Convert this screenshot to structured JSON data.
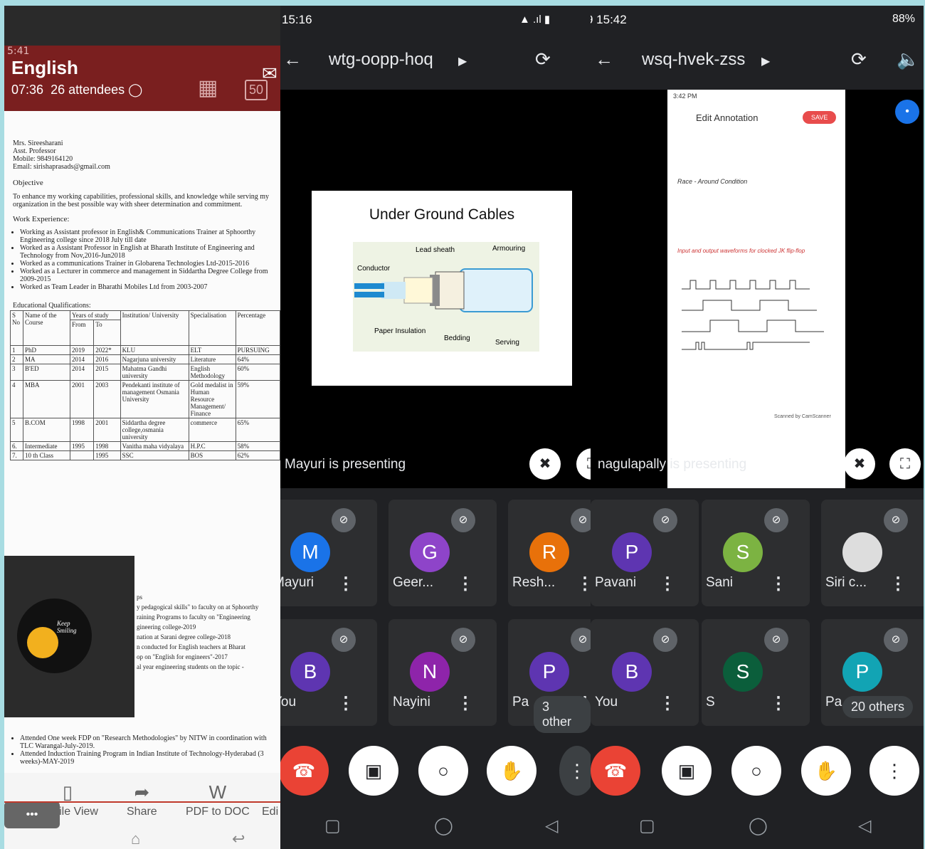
{
  "panel1": {
    "status": "5:41",
    "language": "English",
    "duration": "07:36",
    "attendees": "26 attendees",
    "badge": "50",
    "resume": {
      "name": "Mrs. Sireesharani",
      "role": "Asst. Professor",
      "mobile": "Mobile: 9849164120",
      "email": "Email: sirishaprasads@gmail.com",
      "objective_head": "Objective",
      "objective": "To enhance my working capabilities, professional skills, and knowledge while serving my organization in the best possible way with sheer determination and commitment.",
      "exp_head": "Work Experience:",
      "experience": [
        "Working as Assistant professor in English& Communications Trainer at Sphoorthy Engineering college since 2018 July till date",
        "Worked as a Assistant Professor in English at Bharath Institute of Engineering and Technology from Nov,2016-Jun2018",
        "Worked as a communications Trainer in Globarena Technologies Ltd-2015-2016",
        "Worked as a Lecturer in commerce and management in Siddartha Degree College from 2009-2015",
        "Worked as Team Leader in Bharathi Mobiles Ltd from 2003-2007"
      ],
      "edu_head": "Educational Qualifications:",
      "table_headers": [
        "S No",
        "Name of the Course",
        "Years of study",
        "Institution/ University",
        "Specialisation",
        "Percentage"
      ],
      "sub_headers": [
        "From",
        "To"
      ],
      "rows": [
        [
          "1",
          "PhD",
          "2019",
          "2022*",
          "KLU",
          "ELT",
          "PURSUING"
        ],
        [
          "2",
          "MA",
          "2014",
          "2016",
          "Nagarjuna university",
          "Literature",
          "64%"
        ],
        [
          "3",
          "B'ED",
          "2014",
          "2015",
          "Mahatma Gandhi university",
          "English Methodology",
          "60%"
        ],
        [
          "4",
          "MBA",
          "2001",
          "2003",
          "Pendekanti institute of management Osmania University",
          "Gold medalist in Human Resource Management/ Finance",
          "59%"
        ],
        [
          "5",
          "B.COM",
          "1998",
          "2001",
          "Siddartha degree college,osmania university",
          "commerce",
          "65%"
        ],
        [
          "6.",
          "Intermediate",
          "1995",
          "1998",
          "Vanitha maha vidyalaya",
          "H.P.C",
          "58%"
        ],
        [
          "7.",
          "10 th Class",
          "",
          "1995",
          "SSC",
          "BOS",
          "62%"
        ]
      ],
      "partial_lines": [
        "ps",
        "y pedagogical skills\" to faculty on at Sphoorthy",
        "raining Programs to faculty on \"Engineering",
        "gineering college-2019",
        "nation at Sarani degree college-2018",
        "n conducted for English teachers at Bharat",
        "op on \"English for engineers\"-2017",
        "al year engineering students on the topic -"
      ],
      "bottom_bullets": [
        "Attended One week FDP on \"Research Methodologies\" by NITW in coordination with TLC Warangal-July-2019.",
        "Attended Induction Training Program in Indian Institute of Technology-Hyderabad (3 weeks)-MAY-2019"
      ]
    },
    "video_caption": "Keep Smiling",
    "bottom": [
      "Mobile View",
      "Share",
      "PDF to DOC",
      "Edi"
    ],
    "more": "•••"
  },
  "panel2": {
    "time": "15:16",
    "meeting": "wtg-oopp-hoq",
    "slide_title": "Under Ground Cables",
    "labels": [
      "Lead sheath",
      "Armouring",
      "Conductor",
      "Paper Insulation",
      "Bedding",
      "Serving"
    ],
    "presenting": "Mayuri is presenting",
    "tiles": [
      {
        "initial": "M",
        "name": "Mayuri",
        "color": "#1a73e8"
      },
      {
        "initial": "G",
        "name": "Geer...",
        "color": "#8e44c9"
      },
      {
        "initial": "R",
        "name": "Resh...",
        "color": "#e8710a"
      },
      {
        "initial": "B",
        "name": "You",
        "color": "#5e35b1"
      },
      {
        "initial": "N",
        "name": "Nayini",
        "color": "#8e24aa"
      },
      {
        "initial": "P",
        "name": "Pa",
        "color": "#5e35b1"
      }
    ],
    "others": "3 other"
  },
  "panel3": {
    "time": "9 15:42",
    "battery": "88%",
    "meeting": "wsq-hvek-zss",
    "shared_screen": {
      "status": "3:42 PM",
      "title": "Edit Annotation",
      "save": "SAVE",
      "heading": "Race - Around Condition",
      "subheading": "Input and output waveforms for clocked JK flip-flop",
      "footer": "Scanned by CamScanner"
    },
    "presenting": "nagulapally is presenting",
    "tiles": [
      {
        "initial": "P",
        "name": "Pavani",
        "color": "#5e35b1"
      },
      {
        "initial": "S",
        "name": "Sani",
        "color": "#7cb342"
      },
      {
        "initial": "",
        "name": "Siri c...",
        "color": "#ddd"
      },
      {
        "initial": "B",
        "name": "You",
        "color": "#5e35b1"
      },
      {
        "initial": "S",
        "name": "S",
        "color": "#0b5e3b"
      },
      {
        "initial": "P",
        "name": "Pa",
        "color": "#12a4b4"
      }
    ],
    "others": "20 others"
  }
}
